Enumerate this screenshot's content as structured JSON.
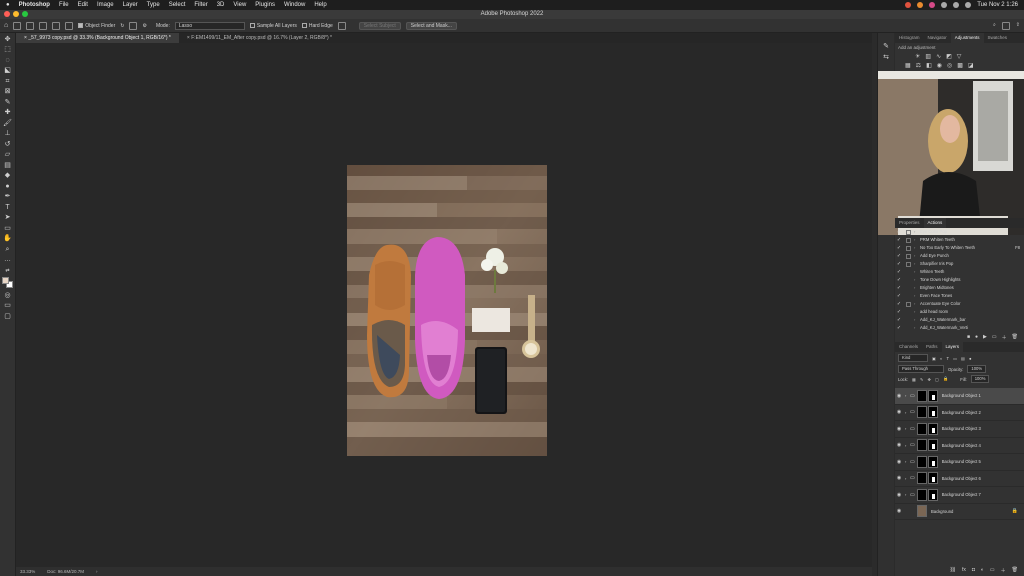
{
  "menubar": {
    "app": "Photoshop",
    "items": [
      "File",
      "Edit",
      "Image",
      "Layer",
      "Type",
      "Select",
      "Filter",
      "3D",
      "View",
      "Plugins",
      "Window",
      "Help"
    ],
    "clock": "Tue Nov 2 1:26"
  },
  "window": {
    "title": "Adobe Photoshop 2022"
  },
  "options": {
    "object_finder": "Object Finder",
    "mode_label": "Mode:",
    "mode_value": "Lasso",
    "sample_all": "Sample All Layers",
    "hard_edge": "Hard Edge",
    "select_subject": "Select Subject",
    "select_mask": "Select and Mask..."
  },
  "tabs": [
    {
      "label": "_57_9973 copy.psd @ 33.3% (Background Object 1, RGB/16*) *"
    },
    {
      "label": "F:EM1499/11_EM_After copy.psd @ 16.7% (Layer 2, RGB/8*) *"
    }
  ],
  "status": {
    "zoom": "33.33%",
    "doc": "Doc: 96.6M/20.7M"
  },
  "panel_top": {
    "tabs": [
      "Histogram",
      "Navigator",
      "Adjustments",
      "Swatches"
    ],
    "hint": "Add an adjustment"
  },
  "actions_panel": {
    "tabs": [
      "Properties",
      "Actions"
    ],
    "items": [
      {
        "label": "Eye Color Pop",
        "box": true
      },
      {
        "label": "PRM Whiten Teeth",
        "box": true
      },
      {
        "label": "No Too Early To Whiten Teeth",
        "box": true,
        "extra": "F8"
      },
      {
        "label": "Add Eye Punch",
        "box": true
      },
      {
        "label": "Sharpifier Iris Pop",
        "box": true
      },
      {
        "label": "Whiten Teeth",
        "box": false
      },
      {
        "label": "Tone Down Highlights",
        "box": false
      },
      {
        "label": "Brighten Midtones",
        "box": false
      },
      {
        "label": "Even Face Tones",
        "box": false
      },
      {
        "label": "Accentuate Eye Color",
        "box": true
      },
      {
        "label": "add head room",
        "box": false
      },
      {
        "label": "Add_KJ_Watermark_bar",
        "box": false
      },
      {
        "label": "Add_KJ_Watermark_Verti",
        "box": false
      }
    ]
  },
  "layers_panel": {
    "tabs": [
      "Channels",
      "Paths",
      "Layers"
    ],
    "kind": "Kind",
    "blend": "Pass Through",
    "opacity_label": "Opacity:",
    "opacity": "100%",
    "lock_label": "Lock:",
    "fill_label": "Fill:",
    "fill": "100%",
    "layers": [
      {
        "name": "Background Object 1",
        "selected": true
      },
      {
        "name": "Background Object 2",
        "selected": false
      },
      {
        "name": "Background Object 3",
        "selected": false
      },
      {
        "name": "Background Object 4",
        "selected": false
      },
      {
        "name": "Background Object 5",
        "selected": false
      },
      {
        "name": "Background Object 6",
        "selected": false
      },
      {
        "name": "Background Object 7",
        "selected": false
      },
      {
        "name": "Background",
        "selected": false
      }
    ]
  },
  "colors": {
    "accent": "#4b8cd8",
    "canvas": "#282828",
    "panel": "#323232"
  }
}
